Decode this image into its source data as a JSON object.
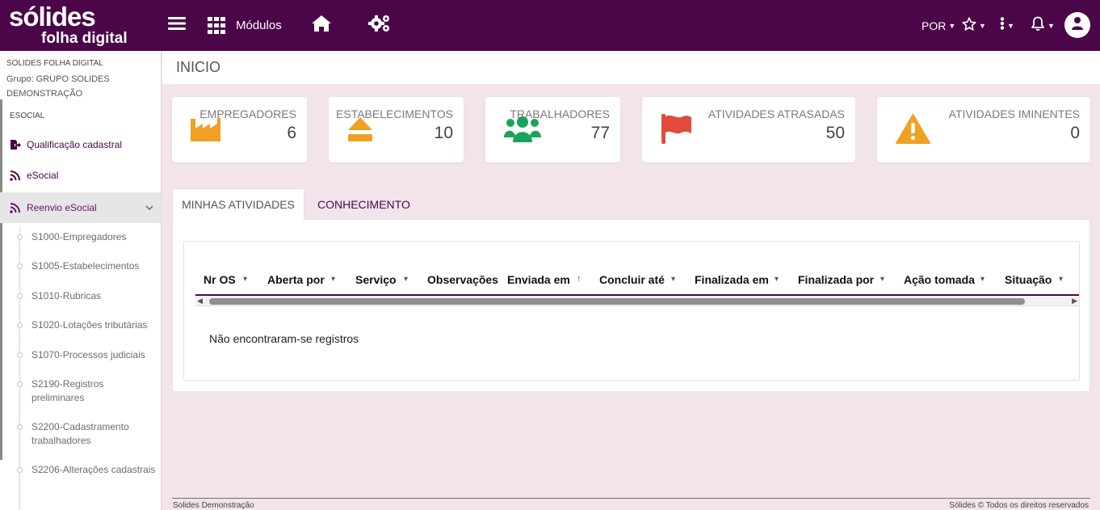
{
  "brand": {
    "line1": "sólides",
    "line2": "folha digital"
  },
  "topbar": {
    "modules_label": "Módulos",
    "language": "POR",
    "colors": {
      "bar": "#4a0648"
    }
  },
  "sidebar": {
    "company": "SOLIDES FOLHA DIGITAL",
    "group": "Grupo: GRUPO SOLIDES DEMONSTRAÇÃO",
    "section": "ESOCIAL",
    "items": [
      {
        "label": "Qualificação cadastral",
        "icon": "file-export-icon"
      },
      {
        "label": "eSocial",
        "icon": "rss-icon"
      },
      {
        "label": "Reenvio eSocial",
        "icon": "rss-icon"
      }
    ],
    "subitems": [
      "S1000-Empregadores",
      "S1005-Estabelecimentos",
      "S1010-Rubricas",
      "S1020-Lotações tributárias",
      "S1070-Processos judiciais",
      "S2190-Registros preliminares",
      "S2200-Cadastramento trabalhadores",
      "S2206-Alterações cadastrais"
    ]
  },
  "page": {
    "title": "INICIO"
  },
  "cards": [
    {
      "label": "EMPREGADORES",
      "value": "6",
      "icon": "factory-icon",
      "color": "#f0a023"
    },
    {
      "label": "ESTABELECIMENTOS",
      "value": "10",
      "icon": "eject-icon",
      "color": "#f0a023"
    },
    {
      "label": "TRABALHADORES",
      "value": "77",
      "icon": "users-icon",
      "color": "#1aa35b"
    },
    {
      "label": "ATIVIDADES ATRASADAS",
      "value": "50",
      "icon": "flag-icon",
      "color": "#e24b3b"
    },
    {
      "label": "ATIVIDADES IMINENTES",
      "value": "0",
      "icon": "warning-icon",
      "color": "#f0a023"
    }
  ],
  "tabs": [
    "MINHAS ATIVIDADES",
    "CONHECIMENTO"
  ],
  "grid": {
    "columns": [
      {
        "label": "Nr OS",
        "ctl": "▾"
      },
      {
        "label": "Aberta por",
        "ctl": "▾"
      },
      {
        "label": "Serviço",
        "ctl": "▾"
      },
      {
        "label": "Observações",
        "ctl": ""
      },
      {
        "label": "Enviada em",
        "ctl": "↑"
      },
      {
        "label": "Concluir até",
        "ctl": "▾"
      },
      {
        "label": "Finalizada em",
        "ctl": "▾"
      },
      {
        "label": "Finalizada por",
        "ctl": "▾"
      },
      {
        "label": "Ação tomada",
        "ctl": "▾"
      },
      {
        "label": "Situação",
        "ctl": "▾"
      }
    ],
    "empty_message": "Não encontraram-se registros"
  },
  "footer": {
    "left": "Solides Demonstração",
    "right": "Sólides © Todos os direitos reservados"
  }
}
